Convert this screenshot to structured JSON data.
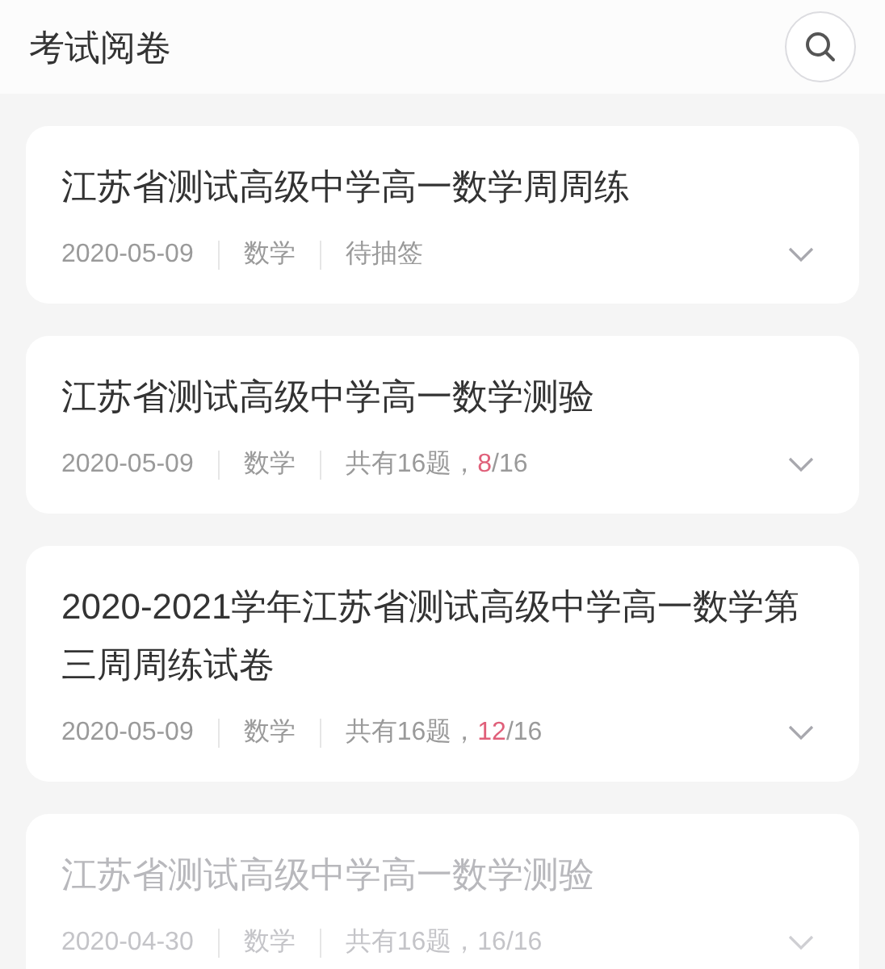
{
  "header": {
    "title": "考试阅卷"
  },
  "exams": [
    {
      "title": "江苏省测试高级中学高一数学周周练",
      "date": "2020-05-09",
      "subject": "数学",
      "kind": "status",
      "status": "待抽签",
      "disabled": false
    },
    {
      "title": "江苏省测试高级中学高一数学测验",
      "date": "2020-05-09",
      "subject": "数学",
      "kind": "progress",
      "count": "共有16题，",
      "done": "8",
      "total": "/16",
      "disabled": false
    },
    {
      "title": "2020-2021学年江苏省测试高级中学高一数学第三周周练试卷",
      "date": "2020-05-09",
      "subject": "数学",
      "kind": "progress",
      "count": "共有16题，",
      "done": "12",
      "total": "/16",
      "disabled": false
    },
    {
      "title": "江苏省测试高级中学高一数学测验",
      "date": "2020-04-30",
      "subject": "数学",
      "kind": "progress",
      "count": "共有16题，",
      "done": "16",
      "total": "/16",
      "disabled": true
    }
  ]
}
